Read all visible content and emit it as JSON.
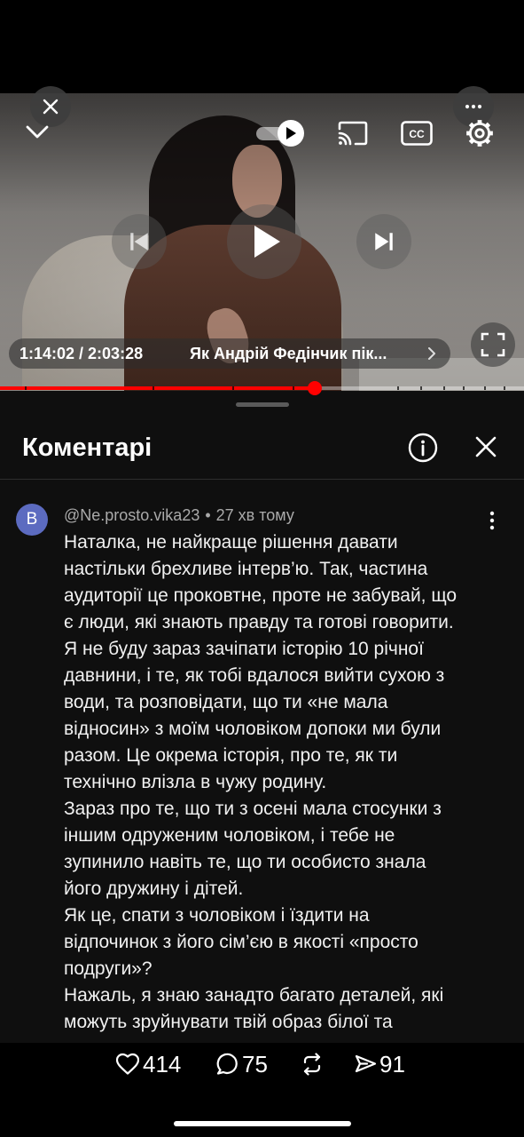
{
  "player": {
    "time_display": "1:14:02 / 2:03:28",
    "video_title": "Як Андрій Федінчик пік...",
    "captions_label": "CC",
    "progress_fraction": 0.6,
    "autoplay_on": true,
    "progress_color": "#ff0000",
    "icons": {
      "minimize": "chevron-down-icon",
      "close": "close-icon",
      "more": "more-horizontal-icon",
      "autoplay": "autoplay-toggle-icon",
      "cast": "cast-icon",
      "captions": "closed-captions-icon",
      "settings": "gear-icon",
      "previous": "skip-previous-icon",
      "play": "play-icon",
      "next": "skip-next-icon",
      "title_more": "chevron-right-icon",
      "fullscreen": "fullscreen-icon"
    }
  },
  "comments_panel": {
    "title": "Коментарі",
    "icons": {
      "info": "info-icon",
      "close": "close-icon",
      "comment_menu": "more-vertical-icon"
    },
    "comments": [
      {
        "avatar_letter": "B",
        "avatar_color": "#5c6bc0",
        "author": "@Ne.prosto.vika23",
        "separator": "•",
        "time_ago": "27 хв тому",
        "lines": [
          "Наталка, не найкраще рішення давати",
          "настільки брехливе інтерв’ю. Так, частина",
          "аудиторії це проковтне, проте не забувай, що",
          "є люди, які знають правду та готові говорити.",
          "Я не буду зараз зачіпати історію 10 річної",
          "давнини, і те, як тобі вдалося вийти сухою з",
          "води, та розповідати, що ти «не мала",
          "відносин» з моїм чоловіком допоки ми були",
          "разом. Це окрема історія, про те, як ти",
          "технічно влізла в чужу родину.",
          "Зараз про те, що ти з осені мала стосунки з",
          "іншим одруженим чоловіком, і тебе не",
          "зупинило навіть те, що ти особисто знала",
          "його дружину і дітей.",
          "Як це, спати з чоловіком і їздити на",
          "відпочинок з його сім’єю в якості «просто",
          "подруги»?",
          "Нажаль, я знаю занадто багато деталей, які",
          "можуть зруйнувати твій образ білої та"
        ]
      }
    ]
  },
  "bottom_bar": {
    "like_count": "414",
    "reply_count": "75",
    "share_count": "91",
    "icons": {
      "like": "heart-icon",
      "reply": "comment-bubble-icon",
      "repost": "repost-icon",
      "share": "send-icon"
    }
  }
}
